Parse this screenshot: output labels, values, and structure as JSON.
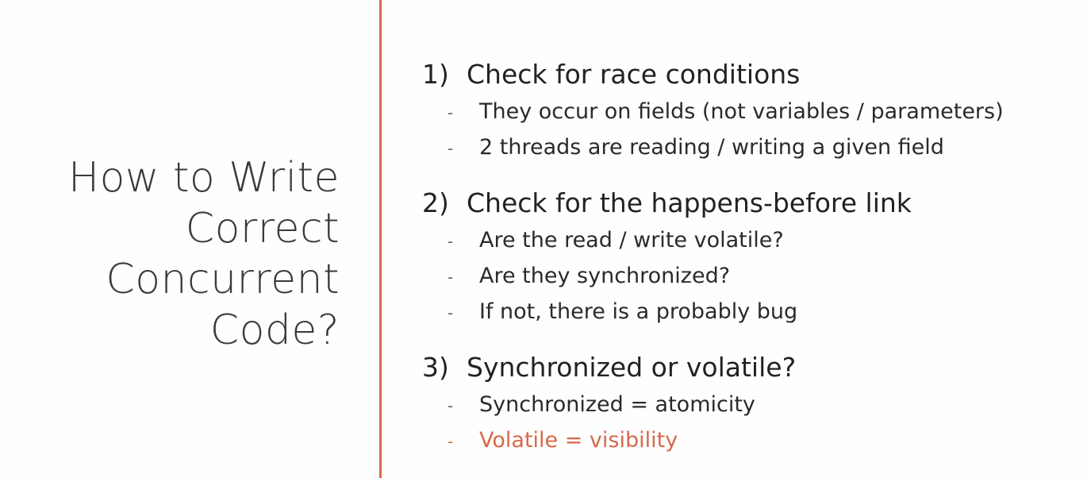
{
  "colors": {
    "accent": "#d6694a",
    "text": "#2a2a2a",
    "background": "#fefefe"
  },
  "title": {
    "lines": [
      "How to Write",
      "Correct",
      "Concurrent",
      "Code?"
    ]
  },
  "sections": [
    {
      "number": "1)",
      "heading": "Check for race conditions",
      "bullets": [
        "They occur on fields (not variables / parameters)",
        "2 threads are reading / writing a given field"
      ]
    },
    {
      "number": "2)",
      "heading": "Check for the happens-before link",
      "bullets": [
        "Are the read / write volatile?",
        "Are they synchronized?",
        "If not, there is a probably bug"
      ]
    },
    {
      "number": "3)",
      "heading": "Synchronized or volatile?",
      "bullets": [
        "Synchronized = atomicity",
        "Volatile = visibility"
      ]
    }
  ],
  "bullet_marker": "-"
}
